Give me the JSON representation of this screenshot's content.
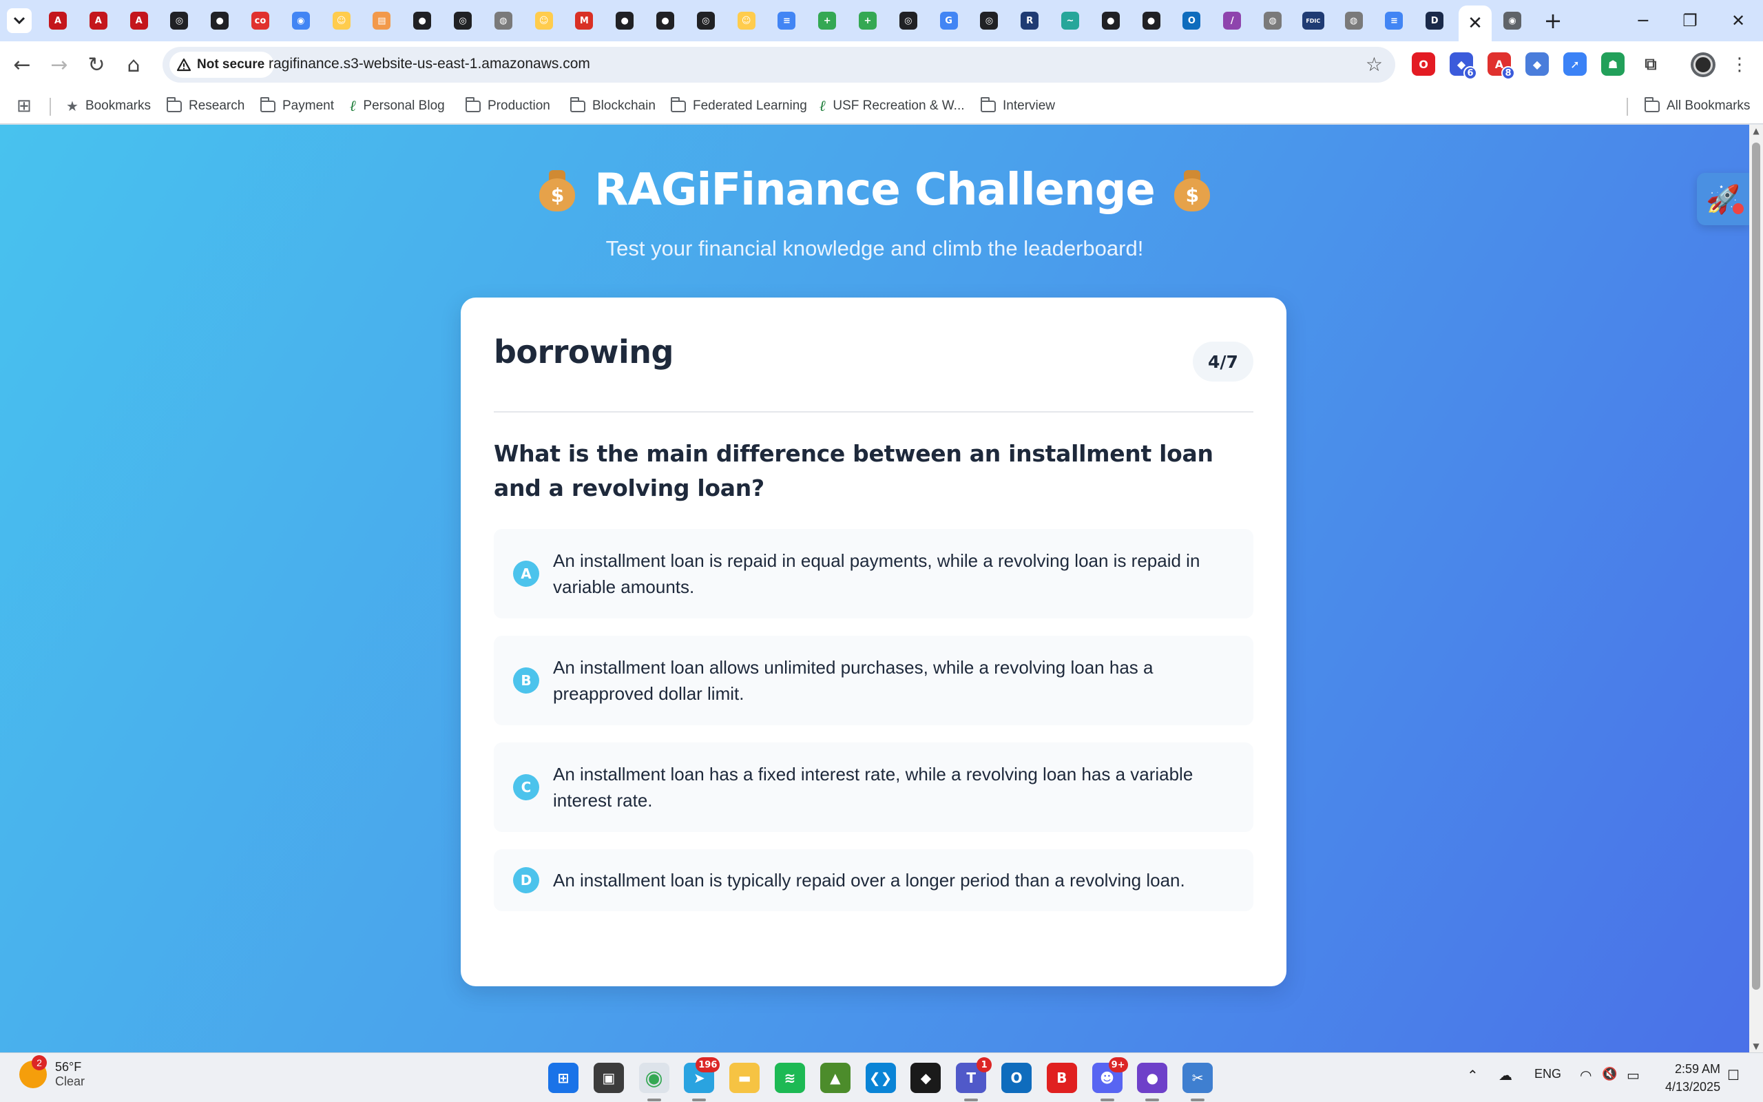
{
  "browser": {
    "tabs": [
      {
        "icon": "pdf-icon",
        "color": "#c4161c",
        "glyph": "A"
      },
      {
        "icon": "pdf-icon",
        "color": "#c4161c",
        "glyph": "A"
      },
      {
        "icon": "pdf-icon",
        "color": "#c4161c",
        "glyph": "A"
      },
      {
        "icon": "openai-icon",
        "color": "#202124",
        "glyph": "◎"
      },
      {
        "icon": "github-icon",
        "color": "#202124",
        "glyph": "●"
      },
      {
        "icon": "coursera-icon",
        "color": "#e0312e",
        "glyph": "co"
      },
      {
        "icon": "chrome-icon",
        "color": "#4285f4",
        "glyph": "◉"
      },
      {
        "icon": "huggingface-icon",
        "color": "#ffcc4d",
        "glyph": "☺"
      },
      {
        "icon": "slides-icon",
        "color": "#f2994a",
        "glyph": "▤"
      },
      {
        "icon": "github-icon",
        "color": "#202124",
        "glyph": "●"
      },
      {
        "icon": "openai-icon",
        "color": "#202124",
        "glyph": "◎"
      },
      {
        "icon": "globe-icon",
        "color": "#7a7a7a",
        "glyph": "◍"
      },
      {
        "icon": "huggingface-icon",
        "color": "#ffcc4d",
        "glyph": "☺"
      },
      {
        "icon": "gmail-icon",
        "color": "#d93025",
        "glyph": "M"
      },
      {
        "icon": "github-icon",
        "color": "#202124",
        "glyph": "●"
      },
      {
        "icon": "github-icon",
        "color": "#202124",
        "glyph": "●"
      },
      {
        "icon": "openai-icon",
        "color": "#202124",
        "glyph": "◎"
      },
      {
        "icon": "huggingface-icon",
        "color": "#ffcc4d",
        "glyph": "☺"
      },
      {
        "icon": "docs-icon",
        "color": "#4285f4",
        "glyph": "≡"
      },
      {
        "icon": "plus-circle-icon",
        "color": "#34a853",
        "glyph": "+"
      },
      {
        "icon": "plus-circle-icon",
        "color": "#34a853",
        "glyph": "+"
      },
      {
        "icon": "openai-icon",
        "color": "#202124",
        "glyph": "◎"
      },
      {
        "icon": "google-icon",
        "color": "#4285f4",
        "glyph": "G"
      },
      {
        "icon": "openai-icon",
        "color": "#202124",
        "glyph": "◎"
      },
      {
        "icon": "r-icon",
        "color": "#1f3b73",
        "glyph": "R"
      },
      {
        "icon": "bird-icon",
        "color": "#26a69a",
        "glyph": "~"
      },
      {
        "icon": "github-icon",
        "color": "#202124",
        "glyph": "●"
      },
      {
        "icon": "github-icon",
        "color": "#202124",
        "glyph": "●"
      },
      {
        "icon": "outlook-icon",
        "color": "#0f6cbd",
        "glyph": "O"
      },
      {
        "icon": "wand-icon",
        "color": "#8e44ad",
        "glyph": "/"
      },
      {
        "icon": "globe-icon",
        "color": "#7a7a7a",
        "glyph": "◍"
      },
      {
        "icon": "fdic-icon",
        "color": "#1f3b73",
        "glyph": "FDIC"
      },
      {
        "icon": "globe-icon",
        "color": "#7a7a7a",
        "glyph": "◍"
      },
      {
        "icon": "docs-icon",
        "color": "#4285f4",
        "glyph": "≡"
      },
      {
        "icon": "d-icon",
        "color": "#1a2a4a",
        "glyph": "D"
      }
    ],
    "active_tab_close": "✕",
    "after_tab": {
      "icon": "chrome-icon",
      "color": "#5f6368",
      "glyph": "◉"
    },
    "new_tab": "+",
    "window": {
      "minimize": "─",
      "restore": "❐",
      "close": "✕"
    },
    "security_label": "Not secure",
    "url": "ragifinance.s3-website-us-east-1.amazonaws.com",
    "extensions": [
      {
        "icon": "opera-icon",
        "color": "#e31b23",
        "glyph": "O",
        "badge": ""
      },
      {
        "icon": "graduation-cap-icon",
        "color": "#3b5bdb",
        "glyph": "◆",
        "badge": "6"
      },
      {
        "icon": "adobe-icon",
        "color": "#e0312e",
        "glyph": "A",
        "badge": "8"
      },
      {
        "icon": "diamond-icon",
        "color": "#4a7ddb",
        "glyph": "◆",
        "badge": ""
      },
      {
        "icon": "rocket-icon",
        "color": "#3b82f6",
        "glyph": "➚",
        "badge": ""
      },
      {
        "icon": "robot-icon",
        "color": "#22a05a",
        "glyph": "☗",
        "badge": ""
      },
      {
        "icon": "puzzle-icon",
        "color": "#ffffff",
        "glyph": "⧉",
        "badge": ""
      }
    ]
  },
  "bookmarks": {
    "apps_icon": "⊞",
    "items": [
      {
        "label": "Bookmarks",
        "type": "star"
      },
      {
        "label": "Research",
        "type": "folder"
      },
      {
        "label": "Payment",
        "type": "folder"
      },
      {
        "label": "Personal Blog",
        "type": "leaf"
      },
      {
        "label": "Production",
        "type": "folder"
      },
      {
        "label": "Blockchain",
        "type": "folder"
      },
      {
        "label": "Federated Learning",
        "type": "folder"
      },
      {
        "label": "USF Recreation & W...",
        "type": "leaf"
      },
      {
        "label": "Interview",
        "type": "folder"
      }
    ],
    "all_bookmarks": "All Bookmarks"
  },
  "app": {
    "title": "RAGiFinance Challenge",
    "title_emoji": "$",
    "subtitle": "Test your financial knowledge and climb the leaderboard!",
    "category": "borrowing",
    "progress": "4/7",
    "progress_current": 4,
    "progress_total": 7,
    "question": "What is the main difference between an installment loan and a revolving loan?",
    "options": [
      {
        "letter": "A",
        "text": "An installment loan is repaid in equal payments, while a revolving loan is repaid in variable amounts."
      },
      {
        "letter": "B",
        "text": "An installment loan allows unlimited purchases, while a revolving loan has a preapproved dollar limit."
      },
      {
        "letter": "C",
        "text": "An installment loan has a fixed interest rate, while a revolving loan has a variable interest rate."
      },
      {
        "letter": "D",
        "text": "An installment loan is typically repaid over a longer period than a revolving loan."
      }
    ],
    "colors": {
      "accent": "#4cc3ec",
      "gradient_start": "#48c2ee",
      "gradient_end": "#4a71e8"
    }
  },
  "taskbar": {
    "weather": {
      "badge": "2",
      "temp": "56°F",
      "condition": "Clear"
    },
    "apps": [
      {
        "name": "start",
        "icon": "windows-icon",
        "color": "#1a73e8",
        "glyph": "⊞",
        "badge": "",
        "active": false
      },
      {
        "name": "task-view",
        "icon": "task-view-icon",
        "color": "#3c3c3c",
        "glyph": "▣",
        "badge": "",
        "active": false
      },
      {
        "name": "chrome",
        "icon": "chrome-icon",
        "color": "#34a853",
        "glyph": "◉",
        "badge": "",
        "active": true
      },
      {
        "name": "telegram",
        "icon": "telegram-icon",
        "color": "#2aa3e0",
        "glyph": "➤",
        "badge": "196",
        "active": true
      },
      {
        "name": "explorer",
        "icon": "folder-icon",
        "color": "#f6c343",
        "glyph": "▬",
        "badge": "",
        "active": false
      },
      {
        "name": "spotify",
        "icon": "spotify-icon",
        "color": "#1db954",
        "glyph": "≋",
        "badge": "",
        "active": false
      },
      {
        "name": "image-viewer",
        "icon": "image-icon",
        "color": "#4c8c2b",
        "glyph": "▲",
        "badge": "",
        "active": false
      },
      {
        "name": "vscode",
        "icon": "vscode-icon",
        "color": "#0a84d6",
        "glyph": "❮❯",
        "badge": "",
        "active": false
      },
      {
        "name": "cursor",
        "icon": "cursor-icon",
        "color": "#1a1a1a",
        "glyph": "◆",
        "badge": "",
        "active": false
      },
      {
        "name": "teams",
        "icon": "teams-icon",
        "color": "#5059c9",
        "glyph": "T",
        "badge": "1",
        "active": true
      },
      {
        "name": "outlook",
        "icon": "outlook-icon",
        "color": "#0f6cbd",
        "glyph": "O",
        "badge": "",
        "active": false
      },
      {
        "name": "app-b",
        "icon": "b-icon",
        "color": "#e02020",
        "glyph": "B",
        "badge": "",
        "active": false
      },
      {
        "name": "discord",
        "icon": "discord-icon",
        "color": "#5865f2",
        "glyph": "☻",
        "badge": "9+",
        "active": true
      },
      {
        "name": "github-desktop",
        "icon": "github-icon",
        "color": "#6e40c9",
        "glyph": "●",
        "badge": "",
        "active": true
      },
      {
        "name": "snipping-tool",
        "icon": "scissors-icon",
        "color": "#3f7fd0",
        "glyph": "✂",
        "badge": "",
        "active": true
      }
    ],
    "tray": {
      "chevron": "⌃",
      "cloud": "☁",
      "language": "ENG",
      "wifi": "◠",
      "volume": "🔇",
      "battery": "▭",
      "time": "2:59 AM",
      "date": "4/13/2025",
      "notifications": "☐"
    }
  }
}
